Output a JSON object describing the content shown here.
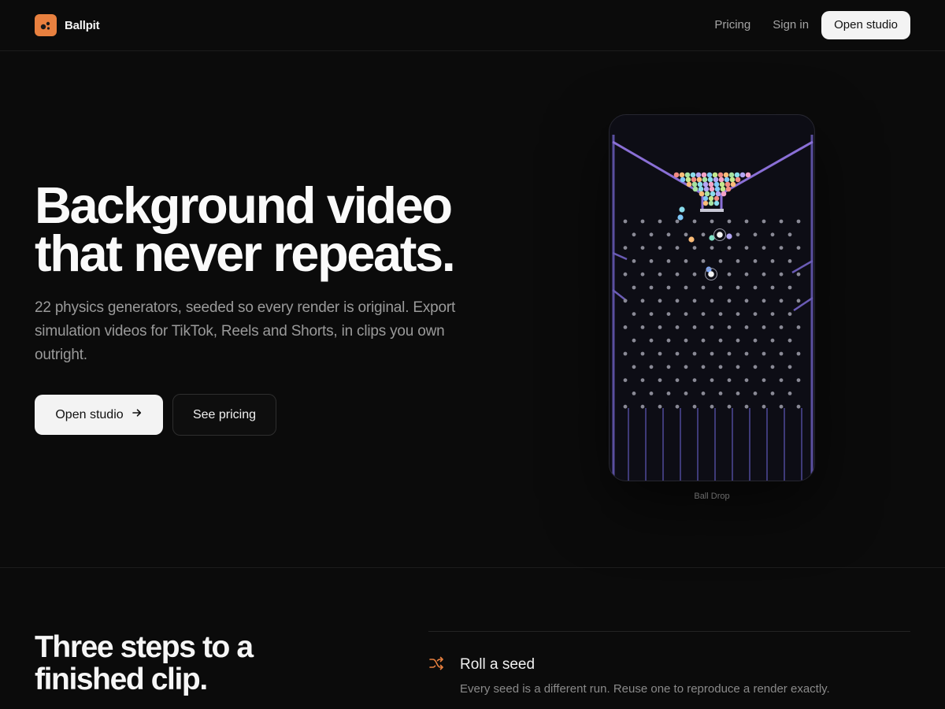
{
  "brand": {
    "name": "Ballpit",
    "accent": "#e8803f"
  },
  "nav": {
    "links": [
      "Pricing",
      "Sign in"
    ],
    "cta": "Open studio"
  },
  "hero": {
    "title_line1": "Background video",
    "title_line2": "that never repeats.",
    "subtitle": "22 physics generators, seeded so every render is original. Export simulation videos for TikTok, Reels and Shorts, in clips you own outright.",
    "primary_button": "Open studio",
    "secondary_button": "See pricing"
  },
  "preview": {
    "caption": "Ball Drop",
    "frame_color": "#8a6fd6"
  },
  "steps": {
    "title_line1": "Three steps to a",
    "title_line2": "finished clip.",
    "items": [
      {
        "icon": "shuffle-icon",
        "title": "Roll a seed",
        "description": "Every seed is a different run. Reuse one to reproduce a render exactly."
      }
    ]
  }
}
